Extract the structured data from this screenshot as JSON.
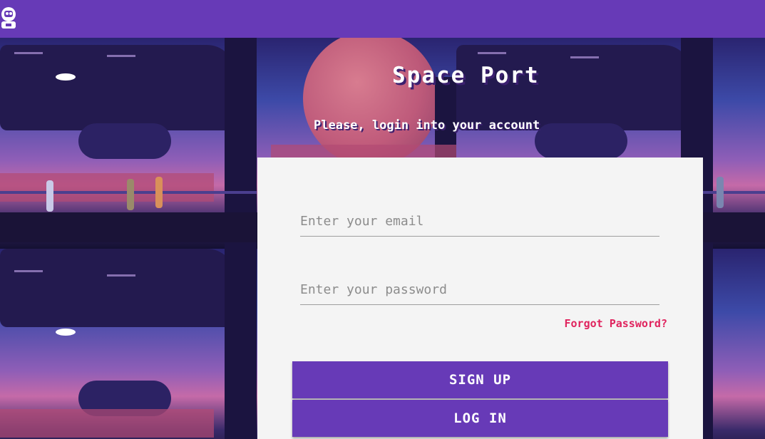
{
  "app": {
    "logo_icon": "robot-icon",
    "title": "Space Port",
    "subtitle": "Please, login into your account"
  },
  "colors": {
    "brand": "#673ab7",
    "accent": "#e0245e",
    "panel": "#f4f4f4"
  },
  "form": {
    "email_placeholder": "Enter your email",
    "password_placeholder": "Enter your password",
    "forgot_label": "Forgot Password?",
    "signup_label": "SIGN UP",
    "login_label": "LOG IN"
  }
}
